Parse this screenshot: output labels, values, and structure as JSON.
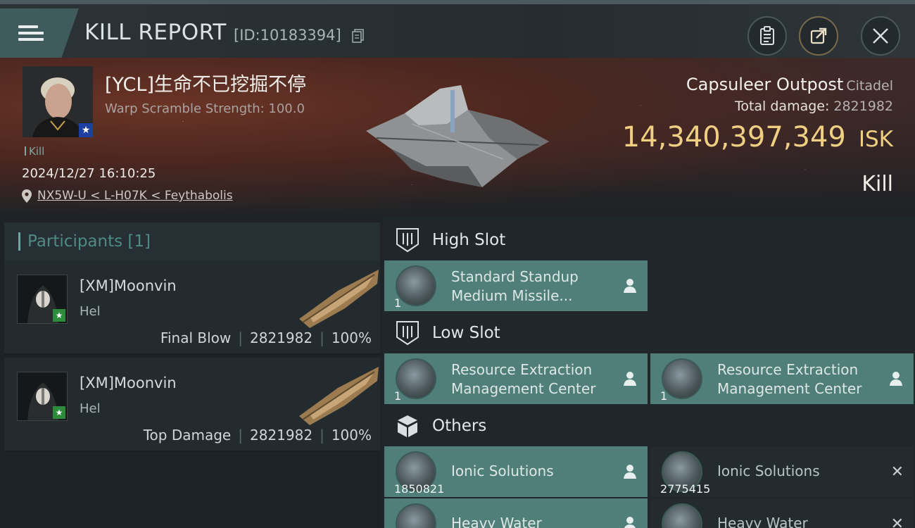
{
  "header": {
    "title": "KILL REPORT",
    "report_id": "[ID:10183394]"
  },
  "victim": {
    "name": "[YCL]生命不已挖掘不停",
    "scramble": "Warp Scramble Strength: 100.0",
    "kill_tag": "Kill",
    "timestamp": "2024/12/27 16:10:25",
    "location": "NX5W-U < L-H07K < Feythabolis"
  },
  "target": {
    "name": "Capsuleer Outpost",
    "class": "Citadel",
    "total_damage_label": "Total damage:",
    "total_damage": "2821982",
    "isk_value": "14,340,397,349",
    "isk_unit": "ISK",
    "result": "Kill"
  },
  "participants": {
    "heading": "Participants [1]",
    "rows": [
      {
        "name": "[XM]Moonvin",
        "ship": "Hel",
        "role": "Final Blow",
        "damage": "2821982",
        "percent": "100%"
      },
      {
        "name": "[XM]Moonvin",
        "ship": "Hel",
        "role": "Top Damage",
        "damage": "2821982",
        "percent": "100%"
      }
    ]
  },
  "slots": {
    "high": {
      "title": "High Slot",
      "items": [
        {
          "name_line1": "Standard Standup",
          "name_line2": "Medium Missile...",
          "qty": "1"
        }
      ]
    },
    "low": {
      "title": "Low Slot",
      "items": [
        {
          "name_line1": "Resource Extraction",
          "name_line2": "Management Center",
          "qty": "1"
        },
        {
          "name_line1": "Resource Extraction",
          "name_line2": "Management Center",
          "qty": "1"
        }
      ]
    },
    "others": {
      "title": "Others",
      "items": [
        {
          "name_line1": "Ionic Solutions",
          "qty": "1850821",
          "state": "dropped"
        },
        {
          "name_line1": "Ionic Solutions",
          "qty": "2775415",
          "state": "destroyed"
        },
        {
          "name_line1": "Heavy Water",
          "state": "dropped"
        },
        {
          "name_line1": "Heavy Water",
          "state": "destroyed"
        }
      ]
    }
  },
  "colors": {
    "accent_teal": "#4f7f78",
    "isk_gold": "#efcf82",
    "participants_label": "#4f8a83"
  }
}
